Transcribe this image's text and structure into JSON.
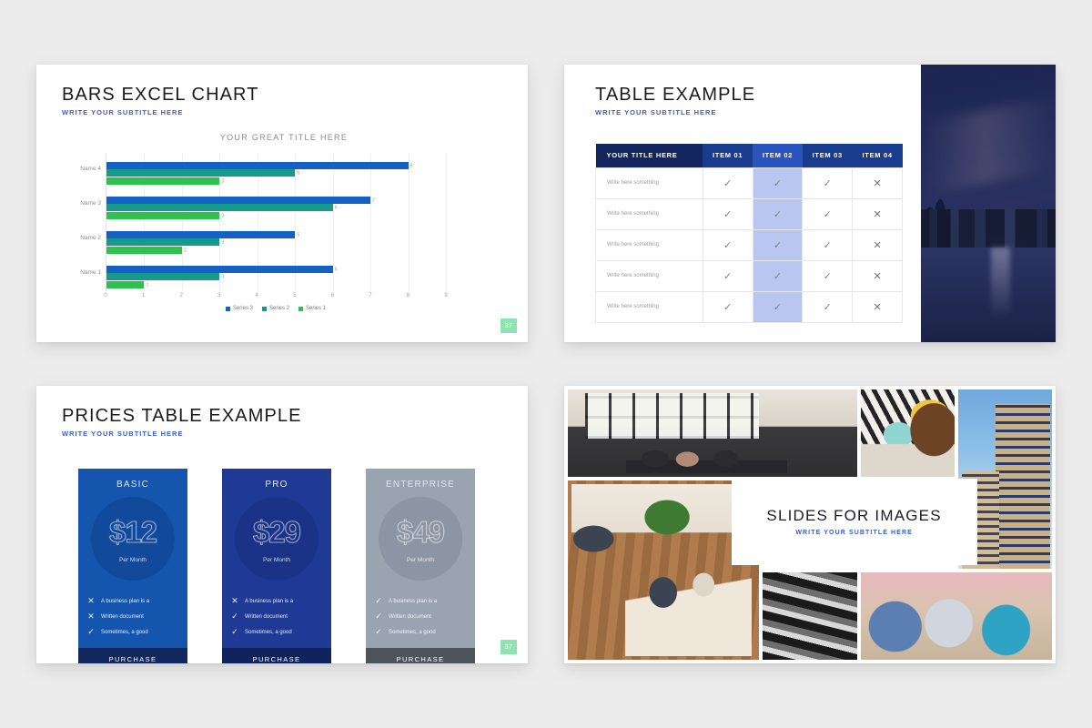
{
  "slides": {
    "chart": {
      "title": "BARS EXCEL CHART",
      "subtitle": "WRITE YOUR SUBTITLE HERE",
      "page_number": "37"
    },
    "table": {
      "title": "TABLE EXAMPLE",
      "subtitle": "WRITE YOUR SUBTITLE HERE",
      "headers": [
        "YOUR TITLE HERE",
        "ITEM 01",
        "ITEM 02",
        "ITEM 03",
        "ITEM 04"
      ],
      "rows": [
        {
          "label": "Write here something",
          "marks": [
            "check",
            "check",
            "check",
            "cross"
          ]
        },
        {
          "label": "Write here something",
          "marks": [
            "check",
            "check",
            "check",
            "cross"
          ]
        },
        {
          "label": "Write here something",
          "marks": [
            "check",
            "check",
            "check",
            "cross"
          ]
        },
        {
          "label": "Write here something",
          "marks": [
            "check",
            "check",
            "check",
            "cross"
          ]
        },
        {
          "label": "Write here something",
          "marks": [
            "check",
            "check",
            "check",
            "cross"
          ]
        }
      ],
      "highlight_column": 2,
      "photo_name": "night-city-skyline-photo"
    },
    "prices": {
      "title": "PRICES TABLE EXAMPLE",
      "subtitle": "WRITE YOUR SUBTITLE HERE",
      "page_number": "37",
      "per_month_label": "Per Month",
      "purchase_label": "PURCHASE",
      "cards": [
        {
          "name": "BASIC",
          "price": "$12",
          "bg": "#1456ae",
          "circle": "#114a9a",
          "footer": "#11275e",
          "features": [
            {
              "mark": "cross",
              "text": "A business plan is a"
            },
            {
              "mark": "cross",
              "text": "Written document"
            },
            {
              "mark": "check",
              "text": "Sometimes, a good"
            }
          ]
        },
        {
          "name": "PRO",
          "price": "$29",
          "bg": "#1f3a94",
          "circle": "#1a3386",
          "footer": "#11235c",
          "features": [
            {
              "mark": "cross",
              "text": "A business plan is a"
            },
            {
              "mark": "check",
              "text": "Written document"
            },
            {
              "mark": "check",
              "text": "Sometimes, a good"
            }
          ]
        },
        {
          "name": "ENTERPRISE",
          "price": "$49",
          "bg": "#9aa3b0",
          "circle": "#8b95a3",
          "footer": "#4e545c",
          "features": [
            {
              "mark": "check",
              "text": "A business plan is a"
            },
            {
              "mark": "check",
              "text": "Written document"
            },
            {
              "mark": "check",
              "text": "Sometimes, a good"
            }
          ]
        }
      ]
    },
    "images": {
      "title": "SLIDES FOR IMAGES",
      "subtitle": "WRITE YOUR SUBTITLE HERE",
      "photos": [
        "office-lounge-meeting-photo",
        "woman-on-sofa-with-phone-photo",
        "highrise-towers-photo",
        "cafe-interior-woman-laptop-photo",
        "building-facade-pattern-photo",
        "team-meeting-table-photo"
      ]
    }
  },
  "chart_data": {
    "type": "bar",
    "orientation": "horizontal",
    "title": "YOUR GREAT TITLE HERE",
    "categories": [
      "Name 1",
      "Name 2",
      "Name 3",
      "Name 4"
    ],
    "series": [
      {
        "name": "Series 1",
        "color": "#2ec14f",
        "values": [
          1,
          2,
          3,
          3
        ]
      },
      {
        "name": "Series 2",
        "color": "#159b8a",
        "values": [
          3,
          3,
          6,
          5
        ]
      },
      {
        "name": "Series 3",
        "color": "#1560c4",
        "values": [
          6,
          5,
          7,
          8
        ]
      }
    ],
    "xticks": [
      0,
      1,
      2,
      3,
      4,
      5,
      6,
      7,
      8,
      9
    ],
    "xlim": [
      0,
      9
    ],
    "xlabel": "",
    "ylabel": "",
    "grid": true,
    "legend_position": "bottom",
    "legend_order": [
      "Series 3",
      "Series 2",
      "Series 1"
    ],
    "data_labels": true
  },
  "marks": {
    "check": "✓",
    "cross": "✕"
  },
  "colors": {
    "background": "#ececec",
    "slide": "#ffffff",
    "accent_blue": "#3a5fbf",
    "title": "#1b1b1b",
    "badge_green": "#8fe3b0"
  }
}
